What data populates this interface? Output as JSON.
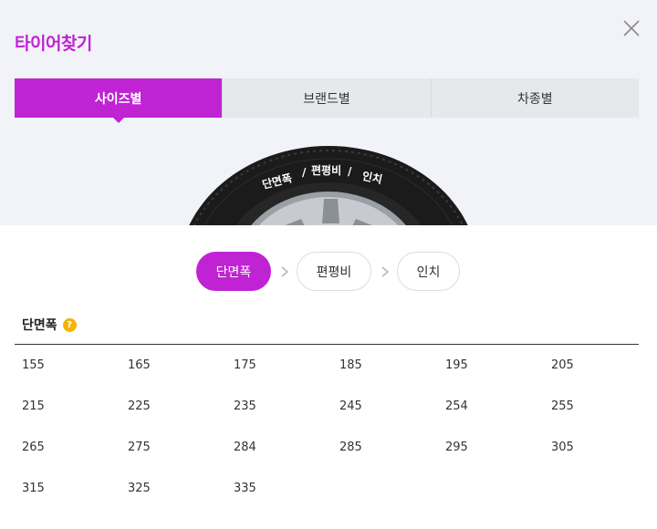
{
  "header": {
    "title": "타이어찾기",
    "close_icon": "close-icon"
  },
  "tabs": [
    {
      "label": "사이즈별",
      "active": true
    },
    {
      "label": "브랜드별",
      "active": false
    },
    {
      "label": "차종별",
      "active": false
    }
  ],
  "tire_image": {
    "labels": [
      "단면폭",
      "/",
      "편평비",
      "/",
      "인치"
    ]
  },
  "steps": [
    {
      "label": "단면폭",
      "active": true
    },
    {
      "label": "편평비",
      "active": false
    },
    {
      "label": "인치",
      "active": false
    }
  ],
  "section": {
    "title": "단면폭",
    "help_glyph": "?"
  },
  "sizes": [
    "155",
    "165",
    "175",
    "185",
    "195",
    "205",
    "215",
    "225",
    "235",
    "245",
    "254",
    "255",
    "265",
    "275",
    "284",
    "285",
    "295",
    "305",
    "315",
    "325",
    "335"
  ],
  "colors": {
    "accent": "#c023d4",
    "help_badge": "#f4b400",
    "top_background": "#f2f3f8"
  }
}
